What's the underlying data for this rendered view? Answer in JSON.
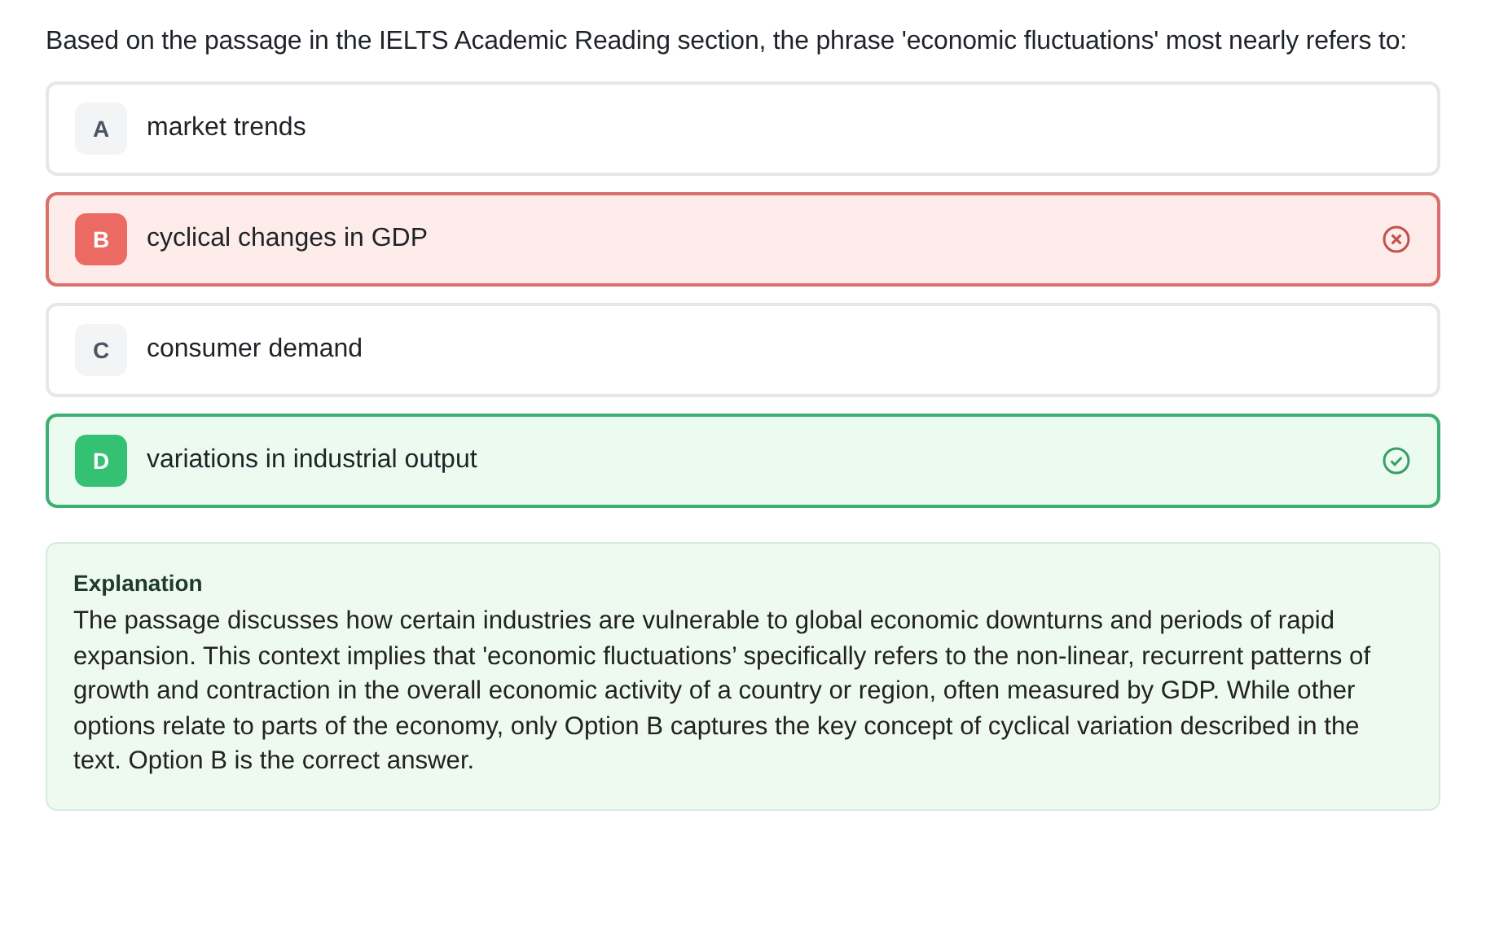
{
  "question": "Based on the passage in the IELTS Academic Reading section, the phrase 'economic fluctuations' most nearly refers to:",
  "options": [
    {
      "letter": "A",
      "text": "market trends",
      "kind": "plain"
    },
    {
      "letter": "B",
      "text": "cyclical changes in GDP",
      "kind": "wrong"
    },
    {
      "letter": "C",
      "text": "consumer demand",
      "kind": "plain"
    },
    {
      "letter": "D",
      "text": "variations in industrial output",
      "kind": "correct"
    }
  ],
  "explanation": {
    "title": "Explanation",
    "text": "The passage discusses how certain industries are vulnerable to global economic downturns and periods of rapid expansion. This context implies that 'economic fluctuations’ specifically refers to the non-linear, recurrent patterns of growth and contraction in the overall economic activity of a country or region, often measured by GDP. While other options relate to parts of the economy, only Option B captures the key concept of cyclical variation described in the text. Option B is the correct answer."
  }
}
